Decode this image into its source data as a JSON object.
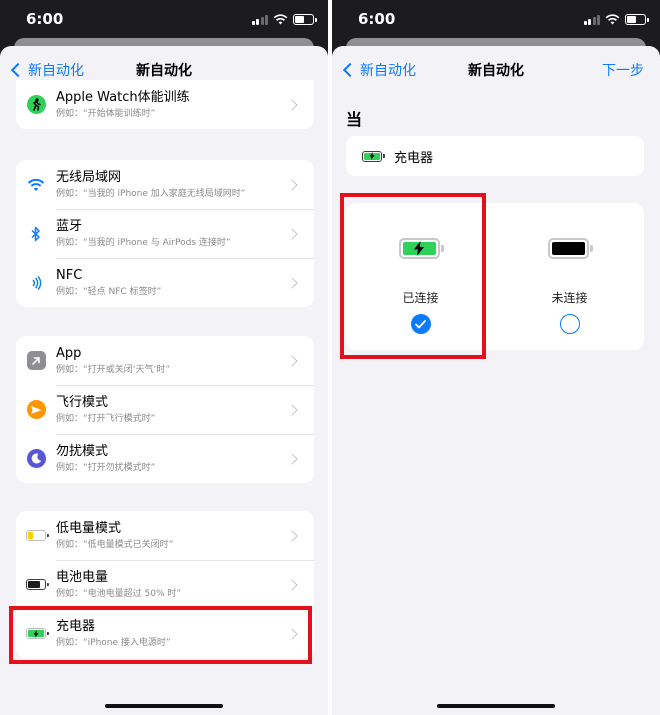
{
  "status": {
    "time": "6:00"
  },
  "left": {
    "nav": {
      "back_label": "新自动化",
      "title": "新自动化"
    },
    "groups": [
      [
        {
          "title": "Apple Watch体能训练",
          "subtitle": "例如：“开始体能训练时”",
          "icon": "workout-figure-icon",
          "color": "#30d158"
        }
      ],
      [
        {
          "title": "无线局域网",
          "subtitle": "例如：“当我的 iPhone 加入家庭无线局域网时”",
          "icon": "wifi-icon",
          "color": "#0a7aff"
        },
        {
          "title": "蓝牙",
          "subtitle": "例如：“当我的 iPhone 与 AirPods 连接时”",
          "icon": "bluetooth-icon",
          "color": "#0a7aff"
        },
        {
          "title": "NFC",
          "subtitle": "例如：“轻点 NFC 标签时”",
          "icon": "nfc-icon",
          "color": "#0a7aff"
        }
      ],
      [
        {
          "title": "App",
          "subtitle": "例如：“打开或关闭‘天气’时”",
          "icon": "app-arrow-icon",
          "color": "#8e8e93"
        },
        {
          "title": "飞行模式",
          "subtitle": "例如：“打开飞行模式时”",
          "icon": "airplane-icon",
          "color": "#ff9500"
        },
        {
          "title": "勿扰模式",
          "subtitle": "例如：“打开勿扰模式时”",
          "icon": "moon-icon",
          "color": "#5856d6"
        }
      ],
      [
        {
          "title": "低电量模式",
          "subtitle": "例如：“低电量模式已关闭时”",
          "icon": "low-battery-icon",
          "color": "#ffcc00"
        },
        {
          "title": "电池电量",
          "subtitle": "例如：“电池电量超过 50% 时”",
          "icon": "battery-level-icon",
          "color": "#1c1c1e"
        },
        {
          "title": "充电器",
          "subtitle": "例如：“iPhone 接入电源时”",
          "icon": "charging-battery-icon",
          "color": "#30d158"
        }
      ]
    ]
  },
  "right": {
    "nav": {
      "back_label": "新自动化",
      "title": "新自动化",
      "next_label": "下一步"
    },
    "section_label": "当",
    "trigger": {
      "label": "充电器",
      "icon": "charging-battery-icon"
    },
    "choices": [
      {
        "label": "已连接",
        "selected": true,
        "icon": "battery-charging-icon"
      },
      {
        "label": "未连接",
        "selected": false,
        "icon": "battery-full-icon"
      }
    ],
    "colors": {
      "accent": "#0a7aff",
      "highlight": "#e3111b",
      "charging": "#30d158"
    }
  }
}
